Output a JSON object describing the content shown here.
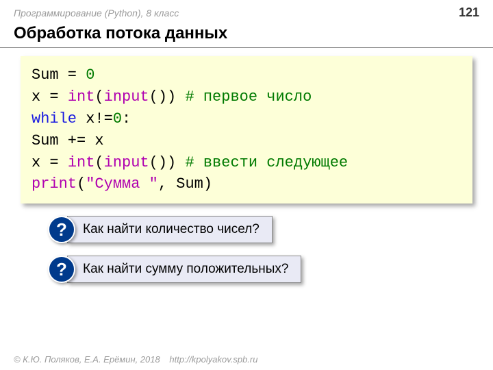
{
  "header": {
    "course": "Программирование (Python), 8 класс",
    "page": "121"
  },
  "title": "Обработка потока данных",
  "code": {
    "l1a": "Sum = ",
    "l1b": "0",
    "l2a": "x = ",
    "l2b": "int",
    "l2c": "(",
    "l2d": "input",
    "l2e": "()) ",
    "l2f": "# первое число",
    "l3a": "while",
    "l3b": " x!=",
    "l3c": "0",
    "l3d": ":",
    "l4a": "  Sum += x",
    "l5a": "  x = ",
    "l5b": "int",
    "l5c": "(",
    "l5d": "input",
    "l5e": "()) ",
    "l5f": "# ввести следующее",
    "l6a": "print",
    "l6b": "(",
    "l6c": "\"Сумма \"",
    "l6d": ", Sum)"
  },
  "questions": {
    "badge": "?",
    "q1": "Как найти количество чисел?",
    "q2": "Как найти сумму положительных?"
  },
  "footer": {
    "authors": "© К.Ю. Поляков, Е.А. Ерёмин, 2018",
    "url": "http://kpolyakov.spb.ru"
  }
}
